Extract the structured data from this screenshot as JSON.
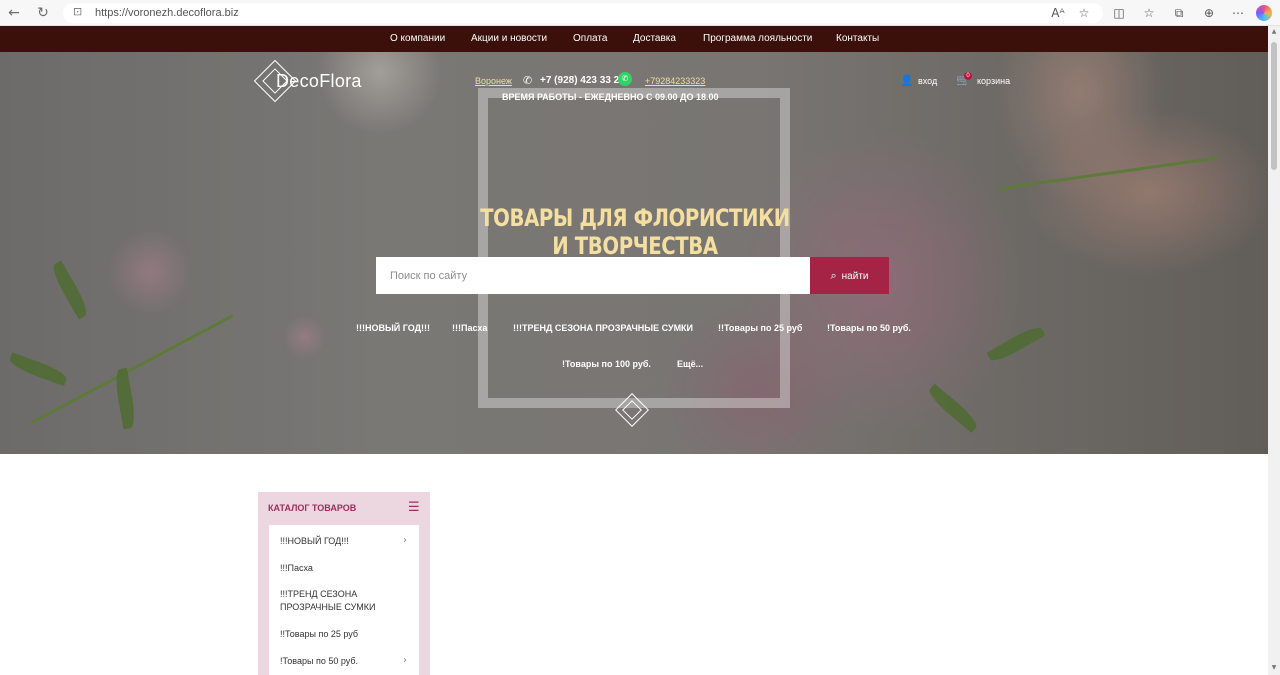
{
  "browser": {
    "url": "https://voronezh.decoflora.biz",
    "icons": [
      "back-icon",
      "refresh-icon",
      "lock-icon",
      "read-aloud-icon",
      "favorite-icon",
      "split-screen-icon",
      "favorites-icon",
      "collections-icon",
      "extensions-icon",
      "more-icon",
      "copilot-icon"
    ]
  },
  "topnav": {
    "items": [
      "О компании",
      "Акции и новости",
      "Оплата",
      "Доставка",
      "Программа лояльности",
      "Контакты"
    ],
    "bg_color": "#3b0f0a"
  },
  "header": {
    "logo_text": "DecoFlora",
    "city": "Воронеж",
    "phone": "+7 (928) 423 33 23",
    "whatsapp": "+79284233323",
    "hours": "ВРЕМЯ РАБОТЫ - ЕЖЕДНЕВНО С 09.00 ДО 18.00",
    "login": "вход",
    "cart": "корзина",
    "cart_count": "0"
  },
  "hero": {
    "headline": "ТОВАРЫ ДЛЯ ФЛОРИСТИКИ И ТВОРЧЕСТВА",
    "search_placeholder": "Поиск по сайту",
    "search_button": "найти",
    "quick_links": [
      "!!!НОВЫЙ ГОД!!!",
      "!!!Пасха",
      "!!!ТРЕНД СЕЗОНА ПРОЗРАЧНЫЕ СУМКИ",
      "!!Товары по 25 руб",
      "!Товары по 50 руб.",
      "!Товары по 100 руб.",
      "Ещё..."
    ],
    "accent_color": "#a52446",
    "headline_color": "#f5dfa0"
  },
  "catalog": {
    "title": "КАТАЛОГ ТОВАРОВ",
    "items": [
      "!!!НОВЫЙ ГОД!!!",
      "!!!Пасха",
      "!!!ТРЕНД СЕЗОНА ПРОЗРАЧНЫЕ СУМКИ",
      "!!Товары по 25 руб",
      "!Товары по 50 руб."
    ],
    "bg_color": "#ecd7e1",
    "title_color": "#9b2e5b"
  }
}
